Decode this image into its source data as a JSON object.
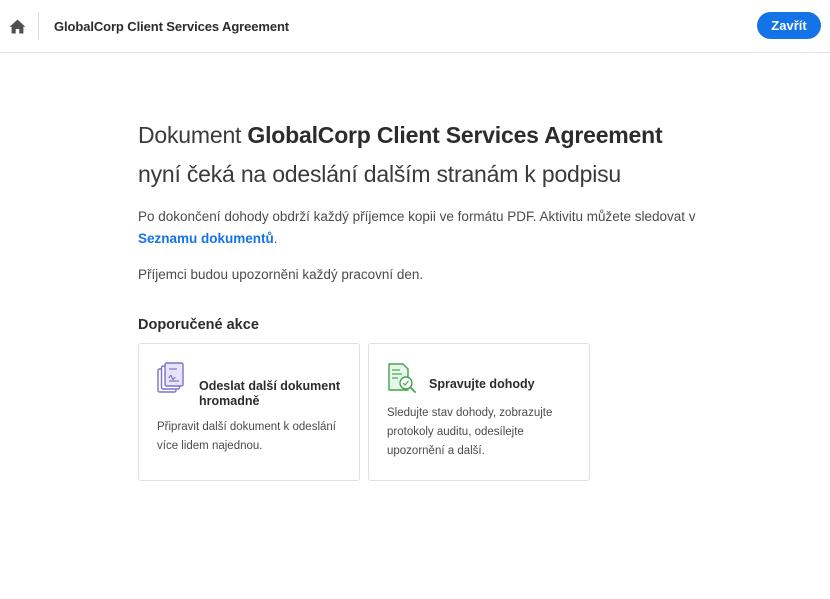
{
  "header": {
    "home_icon": "home-icon",
    "document_title": "GlobalCorp Client Services Agreement",
    "close_label": "Zavřít",
    "accent_color": "#1473e6"
  },
  "main": {
    "heading_prefix": "Dokument ",
    "heading_document": "GlobalCorp Client Services Agreement",
    "heading_suffix": "nyní čeká na odeslání dalším stranám k podpisu",
    "info_text": "Po dokončení dohody obdrží každý příjemce kopii ve formátu PDF. Aktivitu můžete sledovat v ",
    "info_link": "Seznamu dokumentů",
    "info_end": ".",
    "reminder_text": "Příjemci budou upozorněni každý pracovní den.",
    "recommended_title": "Doporučené akce",
    "cards": [
      {
        "icon": "bulk-send-icon",
        "title": "Odeslat další dokument hromadně",
        "description": "Připravit další dokument k odeslání více lidem najednou."
      },
      {
        "icon": "manage-agreements-icon",
        "title": "Spravujte dohody",
        "description": "Sledujte stav dohody, zobrazujte protokoly auditu, odesílejte upozornění a další."
      }
    ]
  }
}
